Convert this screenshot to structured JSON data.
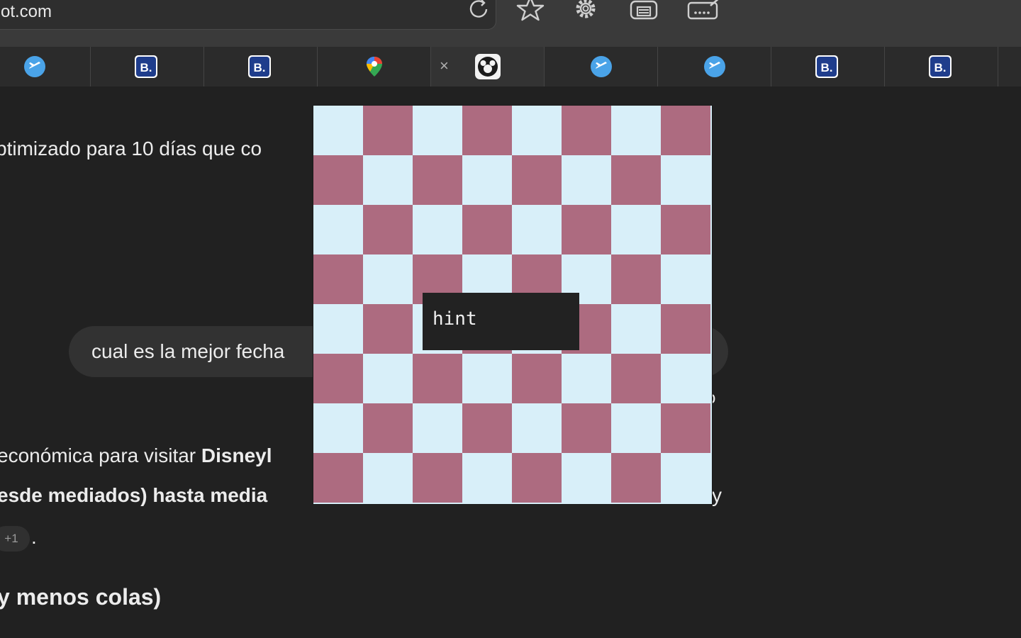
{
  "browser": {
    "url": "ot.com",
    "toolbar_icons": [
      "reload-icon",
      "star-icon",
      "gear-icon",
      "print-icon",
      "keyboard-icon"
    ],
    "tabs": [
      {
        "favicon": "plane-icon",
        "active": false
      },
      {
        "favicon": "booking-icon",
        "label": "B.",
        "active": false
      },
      {
        "favicon": "booking-icon",
        "label": "B.",
        "active": false
      },
      {
        "favicon": "maps-pin-icon",
        "active": false
      },
      {
        "favicon": "mickey-icon",
        "active": true,
        "close": "×"
      },
      {
        "favicon": "plane-icon",
        "active": false
      },
      {
        "favicon": "plane-icon",
        "active": false
      },
      {
        "favicon": "booking-icon",
        "label": "B.",
        "active": false
      },
      {
        "favicon": "booking-icon",
        "label": "B.",
        "active": false
      }
    ]
  },
  "chat": {
    "line1": "ptimizado para 10 días que co",
    "bubble_text": "cual es la mejor fecha",
    "bubble_tail": "o",
    "para_prefix": "económica para visitar ",
    "para_bold": "Disneyl",
    "line_bold": "esde mediados) hasta media",
    "line_end": "y",
    "badge": "+1",
    "badge_suffix": ".",
    "heading": "y menos colas)"
  },
  "game": {
    "board_size": 8,
    "colors": {
      "light": "#d8eff9",
      "dark": "#ad6b80"
    },
    "hint_label": "hint"
  }
}
